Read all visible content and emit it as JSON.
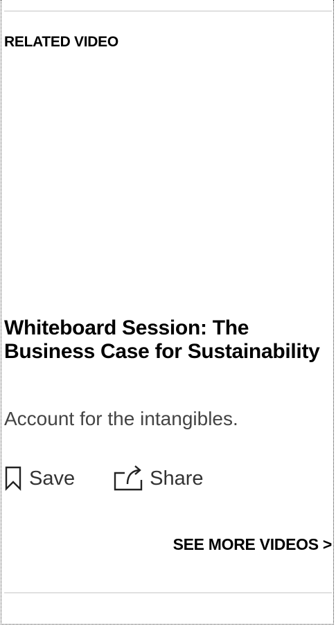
{
  "section": {
    "label": "RELATED VIDEO"
  },
  "video": {
    "title": "Whiteboard Session: The Business Case for Sustainability",
    "dek": "Account for the intangibles."
  },
  "actions": {
    "save_label": "Save",
    "save_icon": "bookmark-icon",
    "share_label": "Share",
    "share_icon": "share-icon"
  },
  "see_more": {
    "label": "SEE MORE VIDEOS >"
  }
}
